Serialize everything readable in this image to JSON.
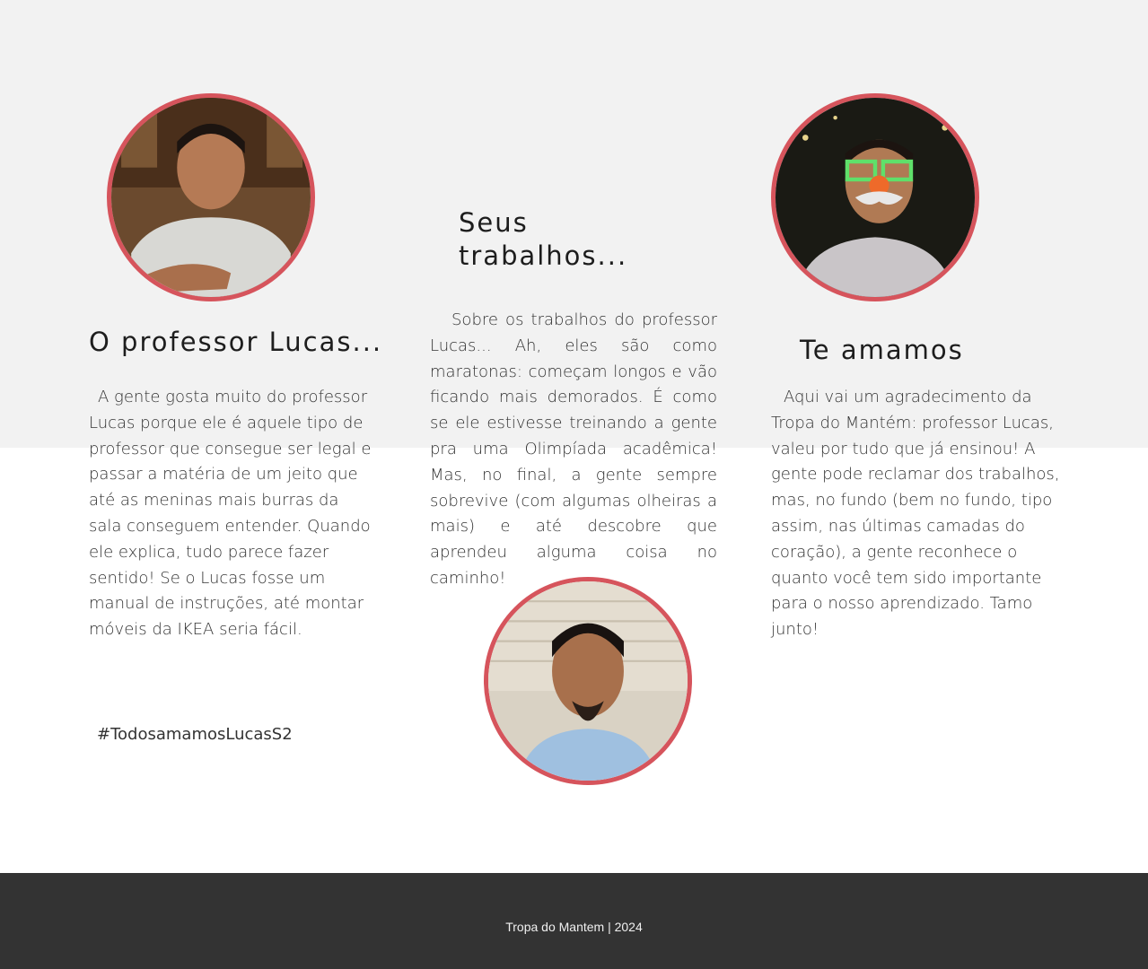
{
  "left": {
    "title": "O professor Lucas...",
    "text": "A gente gosta muito do professor Lucas porque ele é aquele tipo de professor que consegue ser legal e passar a matéria de um jeito que até as meninas mais burras da sala conseguem entender. Quando ele explica, tudo parece fazer sentido! Se o Lucas fosse um manual de instruções, até montar móveis da IKEA seria fácil.",
    "hashtag": "#TodosamamosLucasS2"
  },
  "middle": {
    "title": "Seus trabalhos...",
    "text": "Sobre os trabalhos do professor Lucas... Ah, eles são como maratonas: começam longos e vão ficando mais demorados. É como se ele estivesse treinando a gente pra uma Olimpíada acadêmica! Mas, no final, a gente sempre sobrevive (com algumas olheiras a mais) e até descobre que aprendeu alguma coisa no caminho!"
  },
  "right": {
    "title": "Te amamos",
    "text": "Aqui vai um agradecimento da Tropa do Mantém: professor Lucas, valeu por tudo que já ensinou! A gente pode reclamar dos trabalhos, mas, no fundo (bem no fundo, tipo assim, nas últimas camadas do coração), a gente reconhece o quanto você tem sido importante para o nosso aprendizado. Tamo junto!"
  },
  "footer": {
    "text": "Tropa do Mantem | 2024"
  },
  "colors": {
    "accent_border": "#d6545c",
    "band_background": "#f2f2f2",
    "footer_background": "#333333"
  }
}
